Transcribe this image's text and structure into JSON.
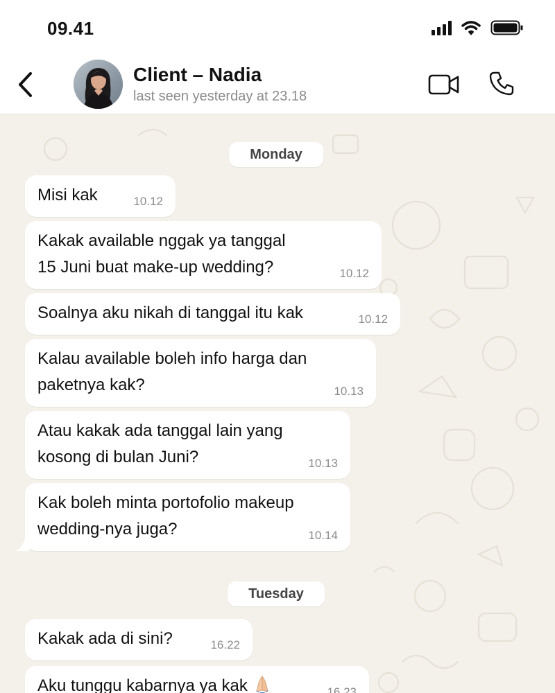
{
  "status_bar": {
    "time": "09.41",
    "icons": [
      "cellular-signal-icon",
      "wifi-icon",
      "battery-icon"
    ]
  },
  "header": {
    "back_icon": "chevron-left-icon",
    "contact_name": "Client – Nadia",
    "last_seen": "last seen yesterday at 23.18",
    "video_icon": "video-camera-icon",
    "voice_icon": "phone-icon"
  },
  "chat": {
    "day_1": "Monday",
    "day_2": "Tuesday",
    "messages": [
      {
        "text": "Misi kak",
        "time": "10.12"
      },
      {
        "text": "Kakak available nggak ya tanggal\n15 Juni buat make-up wedding?",
        "time": "10.12"
      },
      {
        "text": "Soalnya aku nikah di tanggal itu kak",
        "time": "10.12"
      },
      {
        "text": "Kalau available boleh info harga dan\npaketnya kak?",
        "time": "10.13"
      },
      {
        "text": "Atau kakak ada tanggal lain yang\nkosong di bulan Juni?",
        "time": "10.13"
      },
      {
        "text": "Kak boleh minta portofolio makeup\nwedding-nya juga?",
        "time": "10.14"
      },
      {
        "text": "Kakak ada di sini?",
        "time": "16.22"
      },
      {
        "text": "Aku tunggu kabarnya ya kak",
        "time": "16.23",
        "emoji": "folded-hands-emoji"
      }
    ]
  },
  "colors": {
    "background": "#f4f1ea",
    "bubble": "#ffffff",
    "header": "#ffffff",
    "timestamp": "#8b8b8b"
  }
}
